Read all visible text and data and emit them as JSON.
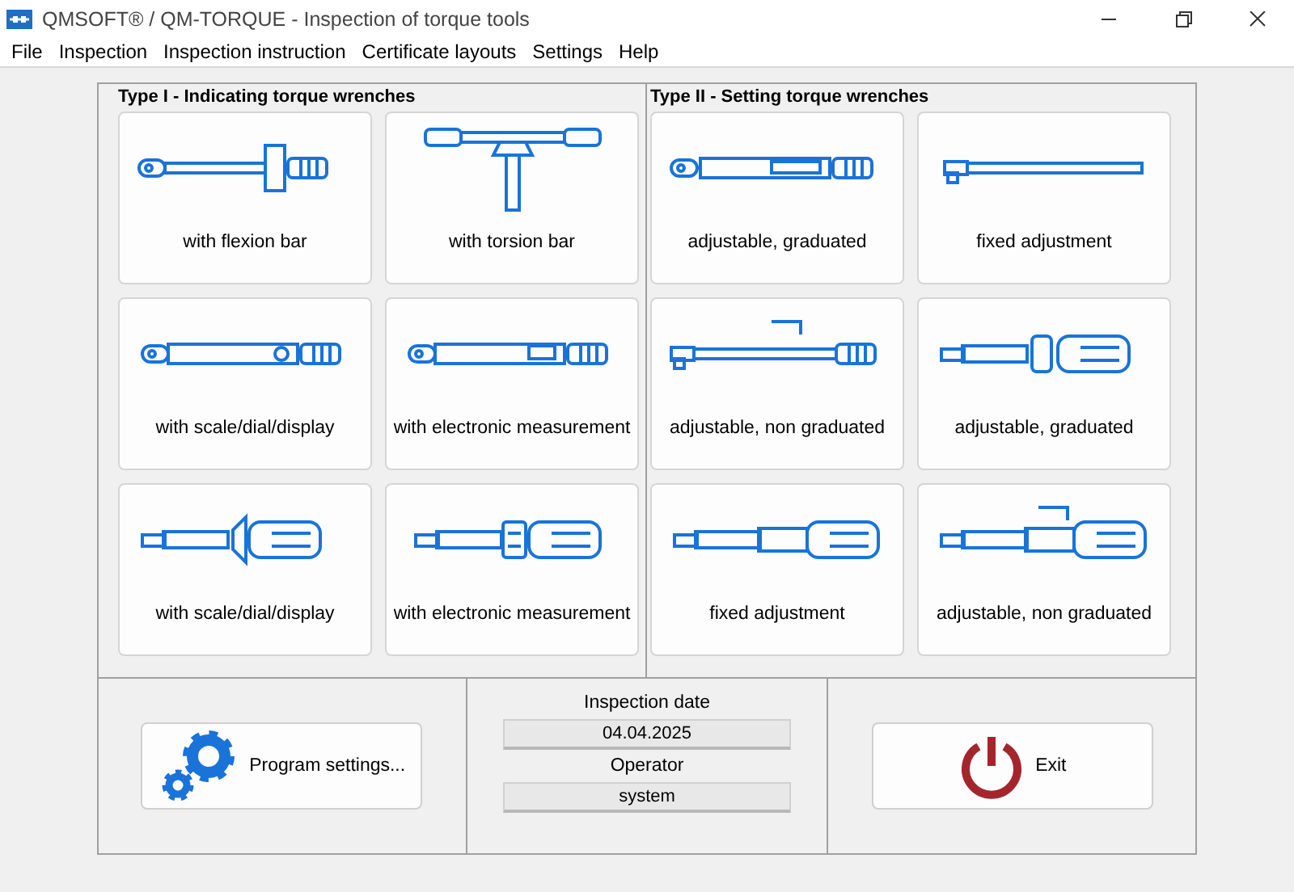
{
  "window": {
    "title": "QMSOFT® / QM-TORQUE - Inspection of torque tools"
  },
  "menu": [
    "File",
    "Inspection",
    "Inspection instruction",
    "Certificate layouts",
    "Settings",
    "Help"
  ],
  "groups": [
    {
      "title": "Type I - Indicating torque wrenches",
      "tools": [
        "with flexion bar",
        "with torsion bar",
        "with scale/dial/display",
        "with electronic measurement",
        "with scale/dial/display",
        "with electronic measurement"
      ]
    },
    {
      "title": "Type II - Setting torque wrenches",
      "tools": [
        "adjustable, graduated",
        "fixed adjustment",
        "adjustable, non graduated",
        "adjustable, graduated",
        "fixed adjustment",
        "adjustable, non graduated"
      ]
    }
  ],
  "inspection_date": {
    "label": "Inspection date",
    "value": "04.04.2025"
  },
  "operator": {
    "label": "Operator",
    "value": "system"
  },
  "buttons": [
    {
      "kind": "settings",
      "label": "Program settings..."
    },
    {
      "kind": "exit",
      "label": "Exit"
    }
  ]
}
